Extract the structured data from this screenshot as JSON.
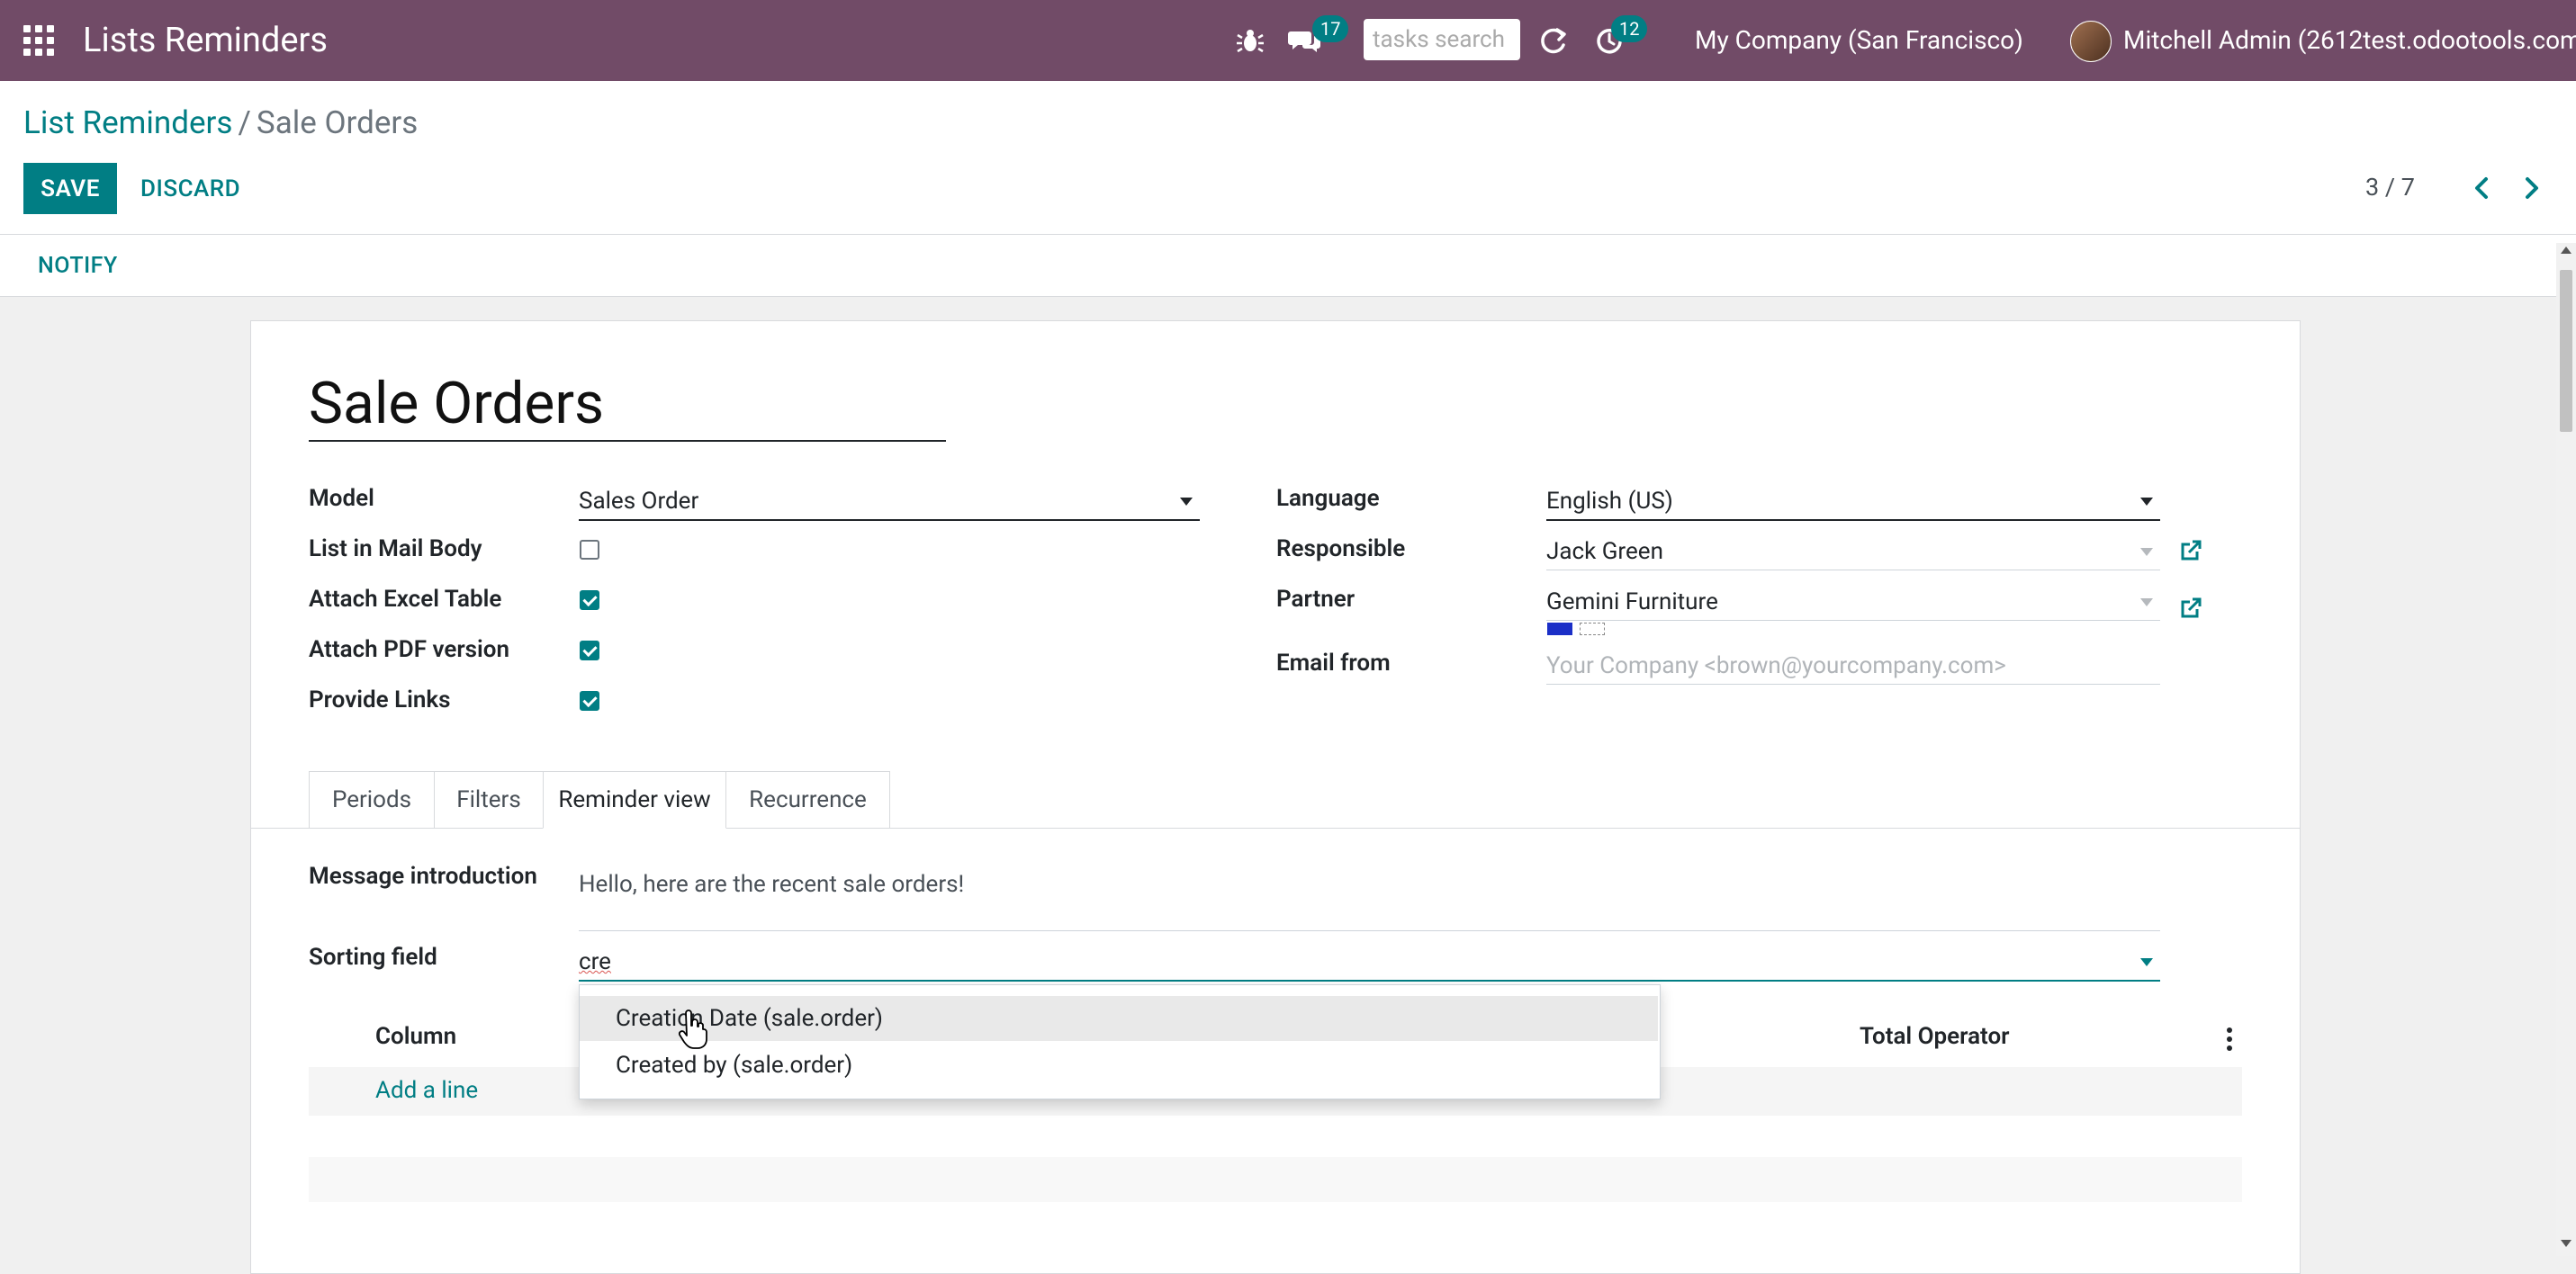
{
  "navbar": {
    "app_title": "Lists Reminders",
    "messages_count": "17",
    "search_placeholder": "tasks search",
    "activities_count": "12",
    "company": "My Company (San Francisco)",
    "user": "Mitchell Admin (2612test.odootools.com)"
  },
  "control_panel": {
    "breadcrumb_parent": "List Reminders",
    "breadcrumb_separator": "/",
    "breadcrumb_current": "Sale Orders",
    "save_label": "SAVE",
    "discard_label": "DISCARD",
    "pager": "3 / 7"
  },
  "statusbar": {
    "notify_label": "NOTIFY"
  },
  "form": {
    "title": "Sale Orders",
    "left": {
      "model_label": "Model",
      "model_value": "Sales Order",
      "list_in_mail_body_label": "List in Mail Body",
      "list_in_mail_body": false,
      "attach_excel_label": "Attach Excel Table",
      "attach_excel": true,
      "attach_pdf_label": "Attach PDF version",
      "attach_pdf": true,
      "provide_links_label": "Provide Links",
      "provide_links": true
    },
    "right": {
      "language_label": "Language",
      "language_value": "English (US)",
      "responsible_label": "Responsible",
      "responsible_value": "Jack Green",
      "partner_label": "Partner",
      "partner_value": "Gemini Furniture",
      "email_from_label": "Email from",
      "email_from_placeholder": "Your Company <brown@yourcompany.com>"
    },
    "tabs": [
      "Periods",
      "Filters",
      "Reminder view",
      "Recurrence"
    ],
    "active_tab": "Reminder view",
    "reminder_view": {
      "message_intro_label": "Message introduction",
      "message_intro_value": "Hello, here are the recent sale orders!",
      "sorting_field_label": "Sorting field",
      "sorting_field_value": "cre",
      "columns_header": {
        "column": "Column",
        "total_operator": "Total Operator"
      },
      "add_line": "Add a line"
    }
  },
  "dropdown": {
    "options": [
      "Creation Date (sale.order)",
      "Created by (sale.order)"
    ],
    "highlighted": "Creation Date (sale.order)"
  },
  "colors": {
    "navbar": "#714b67",
    "accent": "#017e84"
  }
}
